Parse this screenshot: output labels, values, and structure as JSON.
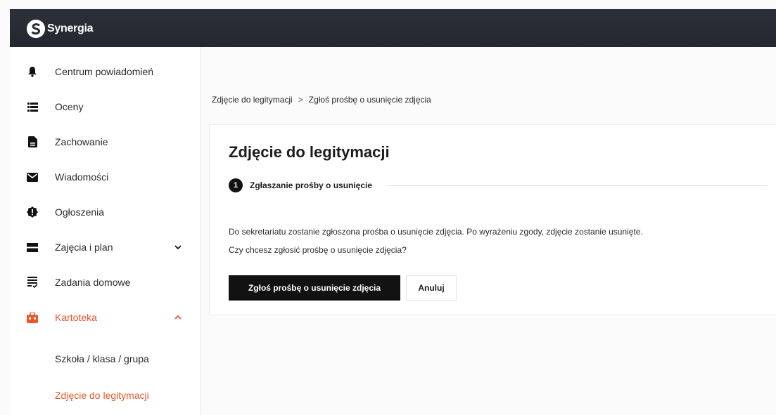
{
  "header": {
    "logo_text": "Synergia",
    "logo_icon": "synergia-logo-icon",
    "background": "#262b33"
  },
  "sidebar": {
    "items": [
      {
        "label": "Centrum powiadomień",
        "icon": "bell-icon"
      },
      {
        "label": "Oceny",
        "icon": "list-icon"
      },
      {
        "label": "Zachowanie",
        "icon": "document-icon"
      },
      {
        "label": "Wiadomości",
        "icon": "envelope-icon"
      },
      {
        "label": "Ogłoszenia",
        "icon": "alert-badge-icon"
      },
      {
        "label": "Zajęcia i plan",
        "icon": "schedule-icon",
        "chevron": "chevron-down-icon"
      },
      {
        "label": "Zadania domowe",
        "icon": "homework-icon"
      },
      {
        "label": "Kartoteka",
        "icon": "briefcase-icon",
        "chevron": "chevron-up-icon",
        "active": true
      }
    ],
    "sub_items": [
      {
        "label": "Szkoła / klasa / grupa"
      },
      {
        "label": "Zdjęcie do legitymacji",
        "active": true
      }
    ],
    "accent_color": "#e8582a"
  },
  "breadcrumb": {
    "parent": "Zdjęcie do legitymacji",
    "separator": ">",
    "current": "Zgłoś prośbę o usunięcie zdjęcia"
  },
  "card": {
    "title": "Zdjęcie do legitymacji",
    "step_number": "1",
    "step_label": "Zgłaszanie prośby o usunięcie",
    "description_line1": "Do sekretariatu zostanie zgłoszona prośba o usunięcie zdjęcia. Po wyrażeniu zgody, zdjęcie zostanie usunięte.",
    "description_line2": "Czy chcesz zgłosić prośbę o usunięcie zdjęcia?",
    "primary_button": "Zgłoś prośbę o usunięcie zdjęcia",
    "secondary_button": "Anuluj"
  }
}
